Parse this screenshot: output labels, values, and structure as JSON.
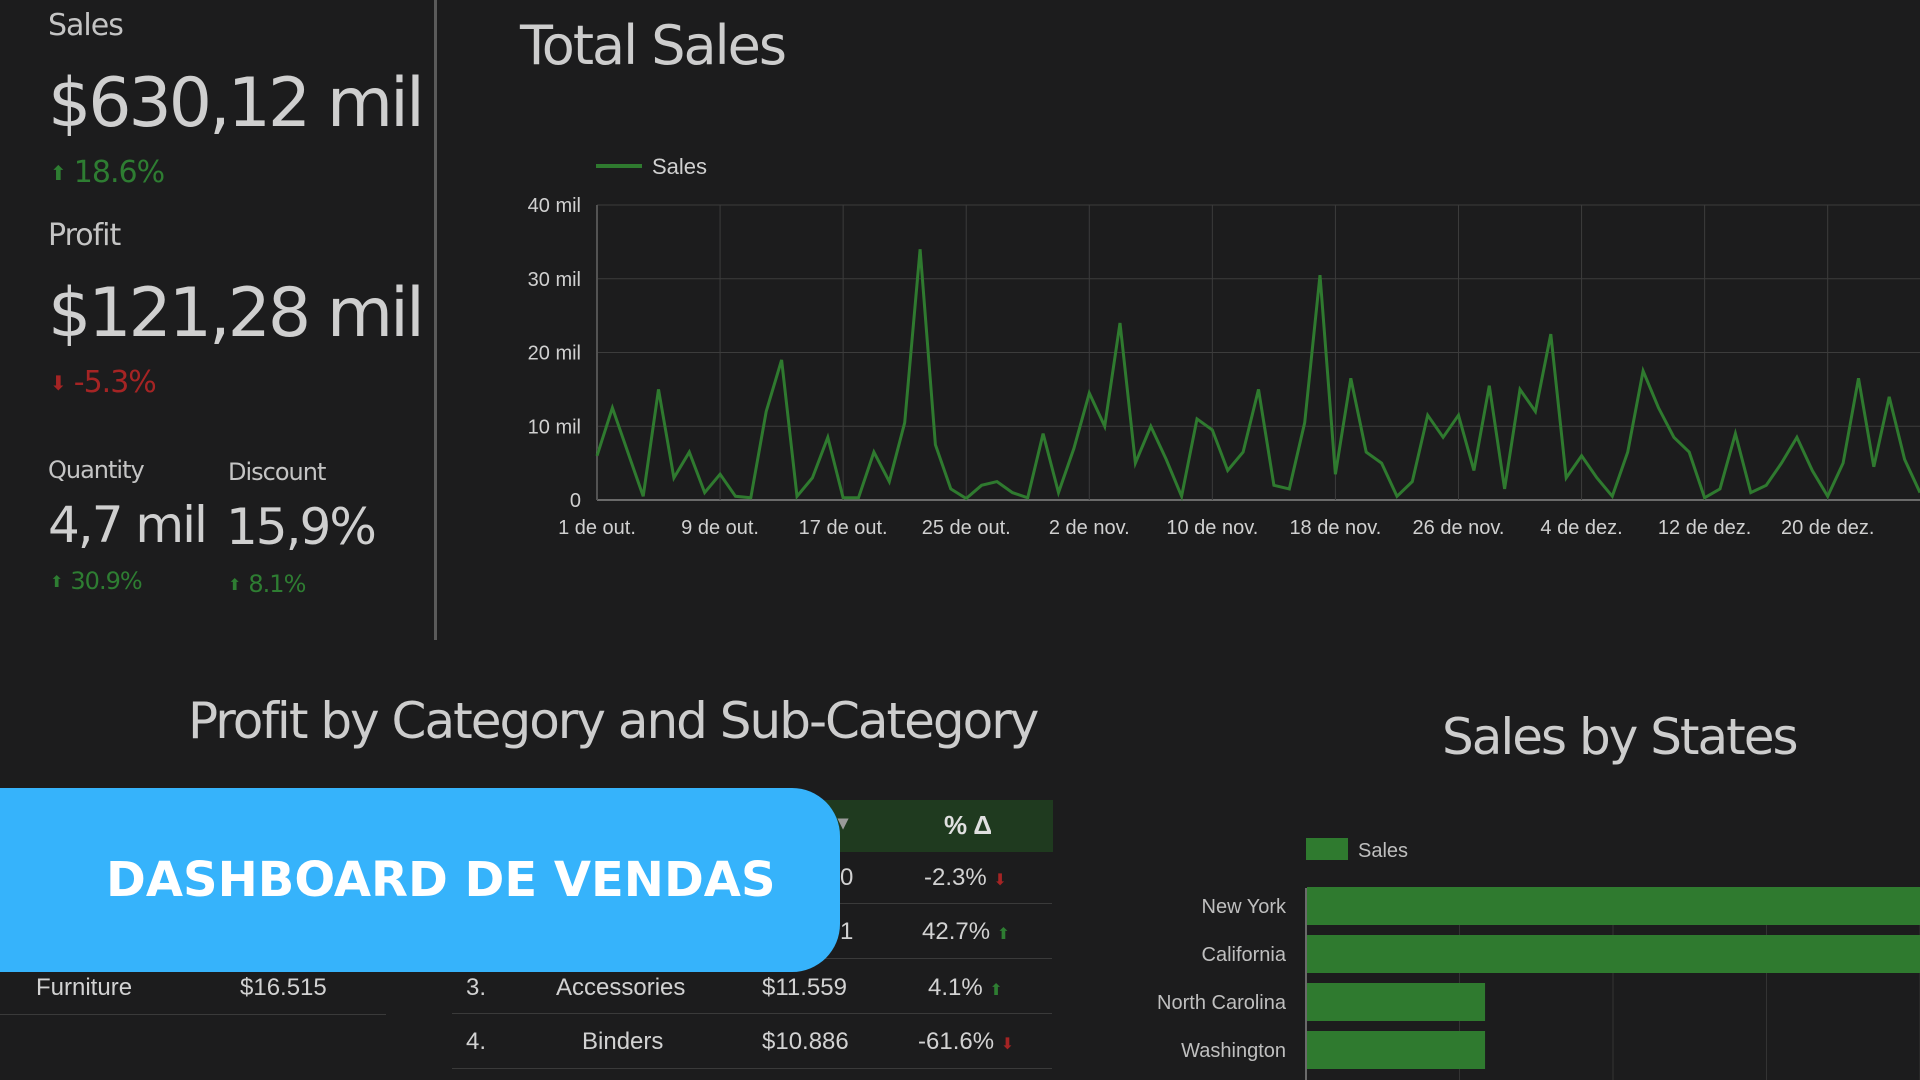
{
  "kpis": {
    "sales": {
      "label": "Sales",
      "value": "$630,12 mil",
      "delta": "18.6%",
      "direction": "up"
    },
    "profit": {
      "label": "Profit",
      "value": "$121,28 mil",
      "delta": "-5.3%",
      "direction": "down"
    },
    "quantity": {
      "label": "Quantity",
      "value": "4,7 mil",
      "delta": "30.9%",
      "direction": "up"
    },
    "discount": {
      "label": "Discount",
      "value": "15,9%",
      "delta": "8.1%",
      "direction": "up"
    }
  },
  "total_sales": {
    "title": "Total Sales"
  },
  "category_section": {
    "title": "Profit by Category and Sub-Category"
  },
  "states_section": {
    "title": "Sales by States"
  },
  "banner": {
    "text": "DASHBOARD DE VENDAS"
  },
  "category_table": {
    "left_rows": [
      {
        "category": "Furniture",
        "profit": "$16.515"
      }
    ],
    "header": {
      "pct": "% Δ",
      "partial_value_glyph": "▾"
    },
    "rows": [
      {
        "rank": "",
        "subcategory": "",
        "profit_tail": "0",
        "pct": "-2.3%",
        "direction": "down"
      },
      {
        "rank": "",
        "subcategory": "",
        "profit_tail": "1",
        "pct": "42.7%",
        "direction": "up"
      },
      {
        "rank": "3.",
        "subcategory": "Accessories",
        "profit": "$11.559",
        "pct": "4.1%",
        "direction": "up"
      },
      {
        "rank": "4.",
        "subcategory": "Binders",
        "profit": "$10.886",
        "pct": "-61.6%",
        "direction": "down"
      }
    ]
  },
  "colors": {
    "accent_green": "#2e7d32",
    "down_red": "#a52424",
    "banner_blue": "#36b3fb",
    "line_green": "#2f7a2f"
  },
  "chart_data": [
    {
      "type": "line",
      "title": "Total Sales",
      "legend": [
        "Sales"
      ],
      "legend_position": "top-left",
      "grid": true,
      "xlabel": "",
      "ylabel": "",
      "ylim": [
        0,
        40000
      ],
      "yticks": [
        "0",
        "10 mil",
        "20 mil",
        "30 mil",
        "40 mil"
      ],
      "xticks": [
        "1 de out.",
        "9 de out.",
        "17 de out.",
        "25 de out.",
        "2 de nov.",
        "10 de nov.",
        "18 de nov.",
        "26 de nov.",
        "4 de dez.",
        "12 de dez.",
        "20 de dez."
      ],
      "series": [
        {
          "name": "Sales",
          "values": [
            6000,
            12500,
            6500,
            500,
            15000,
            3000,
            6500,
            1000,
            3500,
            500,
            300,
            12000,
            19000,
            500,
            3000,
            8500,
            300,
            300,
            6500,
            2500,
            10500,
            34000,
            7500,
            1500,
            200,
            2000,
            2500,
            1000,
            300,
            9000,
            1000,
            7000,
            14500,
            10000,
            24000,
            5000,
            10000,
            5500,
            500,
            11000,
            9500,
            4000,
            6500,
            15000,
            2000,
            1500,
            10500,
            30500,
            3500,
            16500,
            6500,
            5000,
            500,
            2500,
            11500,
            8500,
            11500,
            4000,
            15500,
            1500,
            15000,
            12000,
            22500,
            3000,
            6000,
            3000,
            500,
            6500,
            17500,
            12500,
            8500,
            6500,
            300,
            1500,
            9000,
            1000,
            2000,
            5000,
            8500,
            4000,
            500,
            5000,
            16500,
            4500,
            14000,
            5500,
            1000
          ]
        }
      ]
    },
    {
      "type": "bar",
      "title": "Sales by States",
      "orientation": "horizontal",
      "legend": [
        "Sales"
      ],
      "legend_position": "top-left",
      "categories": [
        "New York",
        "California",
        "North Carolina",
        "Washington"
      ],
      "values": [
        100,
        100,
        29,
        29
      ]
    }
  ]
}
